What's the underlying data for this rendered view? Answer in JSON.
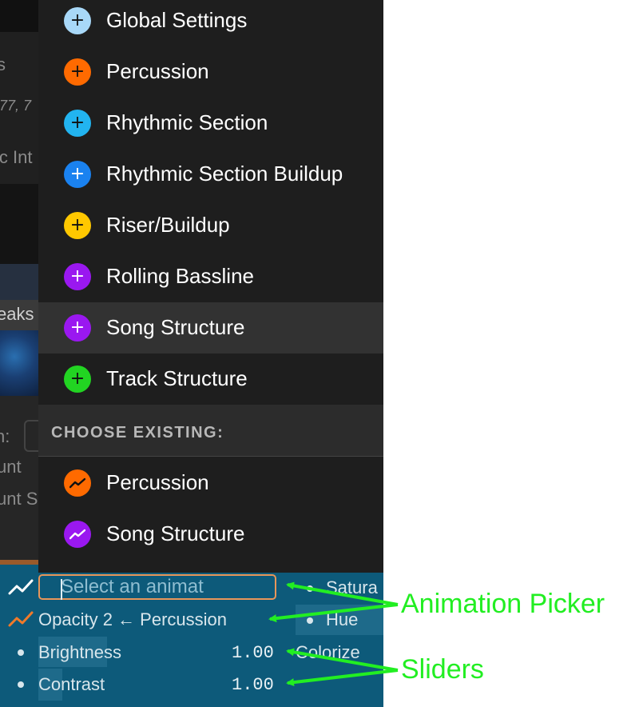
{
  "background": {
    "fragments": [
      "s",
      ".77, 7",
      "ic Int",
      "eaks",
      "n:",
      "unt",
      "unt S"
    ]
  },
  "menu": {
    "create_items": [
      {
        "label": "Global Settings",
        "color": "#a8d8f8",
        "glyph": "+"
      },
      {
        "label": "Percussion",
        "color": "#ff6a00",
        "glyph": "+"
      },
      {
        "label": "Rhythmic Section",
        "color": "#22b4f0",
        "glyph": "+"
      },
      {
        "label": "Rhythmic Section Buildup",
        "color": "#1a82f0",
        "glyph": "+"
      },
      {
        "label": "Riser/Buildup",
        "color": "#ffc800",
        "glyph": "+"
      },
      {
        "label": "Rolling Bassline",
        "color": "#9a18f0",
        "glyph": "+"
      },
      {
        "label": "Song Structure",
        "color": "#9a18f0",
        "glyph": "+",
        "hovered": true
      },
      {
        "label": "Track Structure",
        "color": "#22d422",
        "glyph": "+"
      }
    ],
    "existing_header": "CHOOSE EXISTING:",
    "existing_items": [
      {
        "label": "Percussion",
        "color": "#ff6a00",
        "icon": "animation-curve-icon"
      },
      {
        "label": "Song Structure",
        "color": "#9a18f0",
        "icon": "animation-curve-icon"
      }
    ]
  },
  "panel": {
    "animation_input_placeholder": "Select an animat",
    "opacity_row": "Opacity 2 ← Percussion",
    "sliders": [
      {
        "label": "Brightness",
        "value": "1.00"
      },
      {
        "label": "Contrast",
        "value": "1.00"
      }
    ],
    "right_column": [
      "Satura",
      "Hue",
      "Colorize"
    ]
  },
  "annotations": {
    "animation_picker": "Animation Picker",
    "sliders": "Sliders"
  },
  "colors": {
    "panel_bg": "#0d5a7a",
    "menu_bg": "#1e1e1e",
    "input_border": "#e8965a",
    "annotation": "#22ee22"
  }
}
